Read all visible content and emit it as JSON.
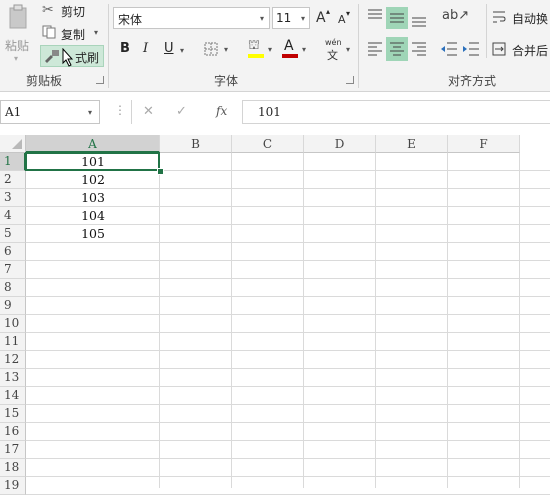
{
  "ribbon": {
    "clipboard": {
      "paste_label": "粘贴",
      "cut_label": "剪切",
      "copy_label": "复制",
      "format_painter_label": "式刷",
      "group_label": "剪贴板"
    },
    "font": {
      "font_name": "宋体",
      "font_size": "11",
      "grow": "A",
      "shrink": "A",
      "bold": "B",
      "italic": "I",
      "underline": "U",
      "font_color_glyph": "A",
      "wen": "wén",
      "wen_char": "文",
      "group_label": "字体"
    },
    "alignment": {
      "wrap_label": "自动换",
      "merge_label": "合并后",
      "group_label": "对齐方式"
    }
  },
  "formula_bar": {
    "name_box": "A1",
    "cancel_glyph": "✕",
    "enter_glyph": "✓",
    "fx_label": "fx",
    "content": "101"
  },
  "sheet": {
    "columns": [
      "A",
      "B",
      "C",
      "D",
      "E",
      "F"
    ],
    "rows": [
      "1",
      "2",
      "3",
      "4",
      "5",
      "6",
      "7",
      "8",
      "9",
      "10",
      "11",
      "12",
      "13",
      "14",
      "15",
      "16",
      "17",
      "18",
      "19"
    ],
    "cells_a": [
      "101",
      "102",
      "103",
      "104",
      "105"
    ]
  },
  "colors": {
    "selection": "#217346",
    "highlight": "#9fd5b7"
  }
}
